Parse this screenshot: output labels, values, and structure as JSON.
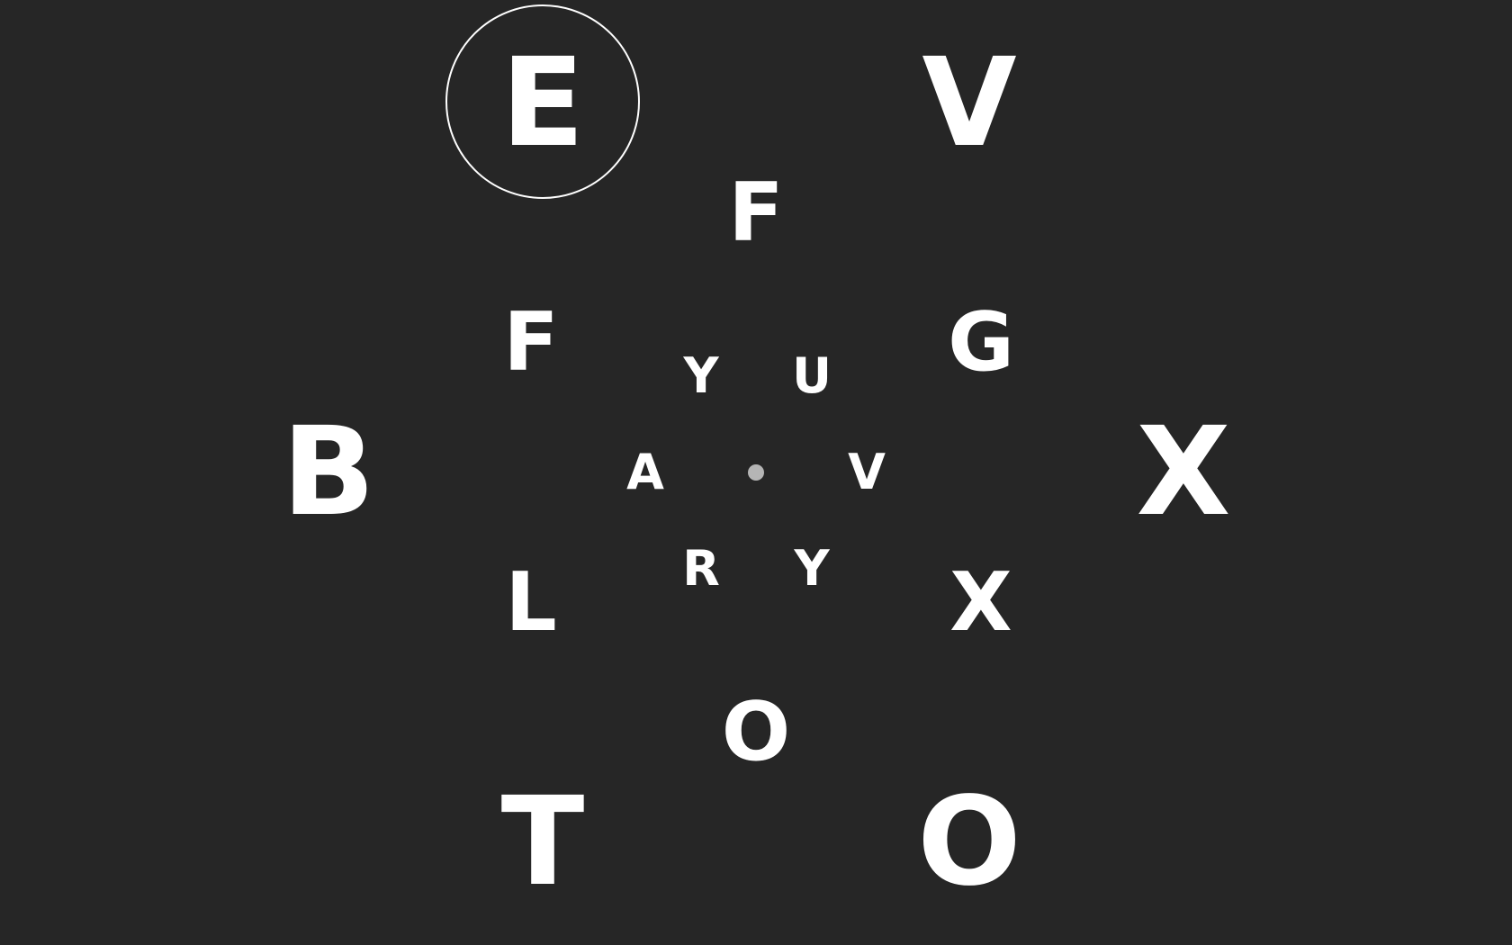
{
  "colors": {
    "background": "#262626",
    "letters": "#ffffff",
    "center_dot": "#b5b5b5"
  },
  "selected": "E",
  "letters": {
    "outer": [
      "E",
      "V",
      "B",
      "X",
      "T",
      "O"
    ],
    "middle": [
      "F",
      "F",
      "G",
      "L",
      "X",
      "O"
    ],
    "inner": [
      "Y",
      "U",
      "A",
      "V",
      "R",
      "Y"
    ]
  }
}
